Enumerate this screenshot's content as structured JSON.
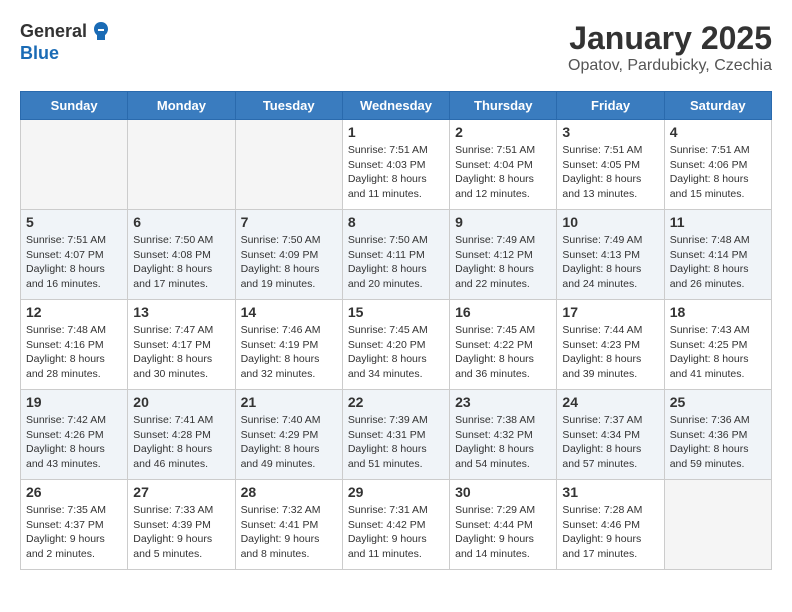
{
  "logo": {
    "general": "General",
    "blue": "Blue"
  },
  "title": "January 2025",
  "subtitle": "Opatov, Pardubicky, Czechia",
  "days_header": [
    "Sunday",
    "Monday",
    "Tuesday",
    "Wednesday",
    "Thursday",
    "Friday",
    "Saturday"
  ],
  "weeks": [
    [
      {
        "day": "",
        "info": ""
      },
      {
        "day": "",
        "info": ""
      },
      {
        "day": "",
        "info": ""
      },
      {
        "day": "1",
        "info": "Sunrise: 7:51 AM\nSunset: 4:03 PM\nDaylight: 8 hours\nand 11 minutes."
      },
      {
        "day": "2",
        "info": "Sunrise: 7:51 AM\nSunset: 4:04 PM\nDaylight: 8 hours\nand 12 minutes."
      },
      {
        "day": "3",
        "info": "Sunrise: 7:51 AM\nSunset: 4:05 PM\nDaylight: 8 hours\nand 13 minutes."
      },
      {
        "day": "4",
        "info": "Sunrise: 7:51 AM\nSunset: 4:06 PM\nDaylight: 8 hours\nand 15 minutes."
      }
    ],
    [
      {
        "day": "5",
        "info": "Sunrise: 7:51 AM\nSunset: 4:07 PM\nDaylight: 8 hours\nand 16 minutes."
      },
      {
        "day": "6",
        "info": "Sunrise: 7:50 AM\nSunset: 4:08 PM\nDaylight: 8 hours\nand 17 minutes."
      },
      {
        "day": "7",
        "info": "Sunrise: 7:50 AM\nSunset: 4:09 PM\nDaylight: 8 hours\nand 19 minutes."
      },
      {
        "day": "8",
        "info": "Sunrise: 7:50 AM\nSunset: 4:11 PM\nDaylight: 8 hours\nand 20 minutes."
      },
      {
        "day": "9",
        "info": "Sunrise: 7:49 AM\nSunset: 4:12 PM\nDaylight: 8 hours\nand 22 minutes."
      },
      {
        "day": "10",
        "info": "Sunrise: 7:49 AM\nSunset: 4:13 PM\nDaylight: 8 hours\nand 24 minutes."
      },
      {
        "day": "11",
        "info": "Sunrise: 7:48 AM\nSunset: 4:14 PM\nDaylight: 8 hours\nand 26 minutes."
      }
    ],
    [
      {
        "day": "12",
        "info": "Sunrise: 7:48 AM\nSunset: 4:16 PM\nDaylight: 8 hours\nand 28 minutes."
      },
      {
        "day": "13",
        "info": "Sunrise: 7:47 AM\nSunset: 4:17 PM\nDaylight: 8 hours\nand 30 minutes."
      },
      {
        "day": "14",
        "info": "Sunrise: 7:46 AM\nSunset: 4:19 PM\nDaylight: 8 hours\nand 32 minutes."
      },
      {
        "day": "15",
        "info": "Sunrise: 7:45 AM\nSunset: 4:20 PM\nDaylight: 8 hours\nand 34 minutes."
      },
      {
        "day": "16",
        "info": "Sunrise: 7:45 AM\nSunset: 4:22 PM\nDaylight: 8 hours\nand 36 minutes."
      },
      {
        "day": "17",
        "info": "Sunrise: 7:44 AM\nSunset: 4:23 PM\nDaylight: 8 hours\nand 39 minutes."
      },
      {
        "day": "18",
        "info": "Sunrise: 7:43 AM\nSunset: 4:25 PM\nDaylight: 8 hours\nand 41 minutes."
      }
    ],
    [
      {
        "day": "19",
        "info": "Sunrise: 7:42 AM\nSunset: 4:26 PM\nDaylight: 8 hours\nand 43 minutes."
      },
      {
        "day": "20",
        "info": "Sunrise: 7:41 AM\nSunset: 4:28 PM\nDaylight: 8 hours\nand 46 minutes."
      },
      {
        "day": "21",
        "info": "Sunrise: 7:40 AM\nSunset: 4:29 PM\nDaylight: 8 hours\nand 49 minutes."
      },
      {
        "day": "22",
        "info": "Sunrise: 7:39 AM\nSunset: 4:31 PM\nDaylight: 8 hours\nand 51 minutes."
      },
      {
        "day": "23",
        "info": "Sunrise: 7:38 AM\nSunset: 4:32 PM\nDaylight: 8 hours\nand 54 minutes."
      },
      {
        "day": "24",
        "info": "Sunrise: 7:37 AM\nSunset: 4:34 PM\nDaylight: 8 hours\nand 57 minutes."
      },
      {
        "day": "25",
        "info": "Sunrise: 7:36 AM\nSunset: 4:36 PM\nDaylight: 8 hours\nand 59 minutes."
      }
    ],
    [
      {
        "day": "26",
        "info": "Sunrise: 7:35 AM\nSunset: 4:37 PM\nDaylight: 9 hours\nand 2 minutes."
      },
      {
        "day": "27",
        "info": "Sunrise: 7:33 AM\nSunset: 4:39 PM\nDaylight: 9 hours\nand 5 minutes."
      },
      {
        "day": "28",
        "info": "Sunrise: 7:32 AM\nSunset: 4:41 PM\nDaylight: 9 hours\nand 8 minutes."
      },
      {
        "day": "29",
        "info": "Sunrise: 7:31 AM\nSunset: 4:42 PM\nDaylight: 9 hours\nand 11 minutes."
      },
      {
        "day": "30",
        "info": "Sunrise: 7:29 AM\nSunset: 4:44 PM\nDaylight: 9 hours\nand 14 minutes."
      },
      {
        "day": "31",
        "info": "Sunrise: 7:28 AM\nSunset: 4:46 PM\nDaylight: 9 hours\nand 17 minutes."
      },
      {
        "day": "",
        "info": ""
      }
    ]
  ]
}
